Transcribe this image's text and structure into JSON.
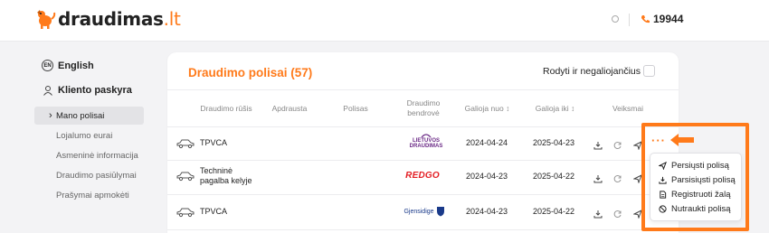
{
  "header": {
    "logo_text_main": "draudimas",
    "logo_text_domain": ".lt",
    "phone": "19944"
  },
  "sidebar": {
    "language": "English",
    "lang_code": "EN",
    "account": "Kliento paskyra",
    "items": [
      {
        "label": "Mano polisai",
        "active": true
      },
      {
        "label": "Lojalumo eurai",
        "active": false
      },
      {
        "label": "Asmeninė informacija",
        "active": false
      },
      {
        "label": "Draudimo pasiūlymai",
        "active": false
      },
      {
        "label": "Prašymai apmokėti",
        "active": false
      }
    ]
  },
  "main": {
    "title": "Draudimo polisai (57)",
    "show_invalid_label": "Rodyti ir negaliojančius",
    "columns": {
      "type": "Draudimo rūšis",
      "insured": "Apdrausta",
      "policy": "Polisas",
      "insurer_line1": "Draudimo",
      "insurer_line2": "bendrovė",
      "valid_from": "Galioja nuo",
      "valid_to": "Galioja iki",
      "actions": "Veiksmai"
    },
    "rows": [
      {
        "type": "TPVCA",
        "insurer": "LIETUVOS DRAUDIMAS",
        "insurer_line1": "LIETUVOS",
        "insurer_line2": "DRAUDIMAS",
        "valid_from": "2024-04-24",
        "valid_to": "2025-04-23"
      },
      {
        "type_line1": "Techninė",
        "type_line2": "pagalba kelyje",
        "insurer": "REDGO",
        "valid_from": "2024-04-23",
        "valid_to": "2025-04-22"
      },
      {
        "type": "TPVCA",
        "insurer": "Gjensidige",
        "valid_from": "2024-04-23",
        "valid_to": "2025-04-22"
      }
    ]
  },
  "menu": {
    "items": [
      {
        "label": "Persiųsti polisą",
        "icon": "send-icon"
      },
      {
        "label": "Parsisiųsti polisą",
        "icon": "download-icon"
      },
      {
        "label": "Registruoti žalą",
        "icon": "document-icon"
      },
      {
        "label": "Nutraukti polisą",
        "icon": "cancel-icon"
      }
    ],
    "dots": "···"
  },
  "colors": {
    "accent": "#ff7a1a",
    "text": "#222222",
    "muted": "#888888",
    "background": "#f3f3f5",
    "ld_purple": "#6b2a86",
    "redgo_red": "#e31e24",
    "gjensidige_blue": "#1a3a8a"
  }
}
